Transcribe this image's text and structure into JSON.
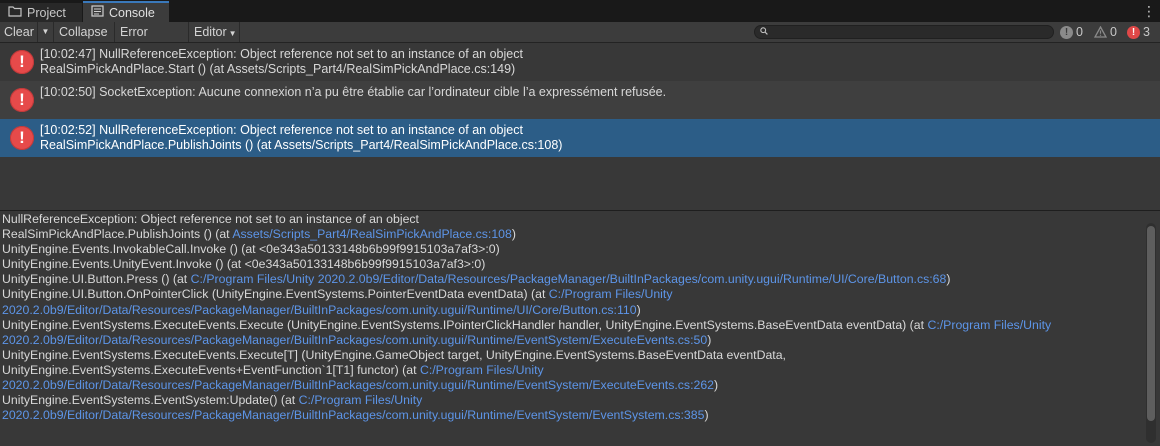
{
  "tabs": [
    {
      "label": "Project",
      "icon": "folder-icon"
    },
    {
      "label": "Console",
      "icon": "console-icon"
    }
  ],
  "toolbar": {
    "clear": "Clear",
    "collapse": "Collapse",
    "error_pause": "Error Pause",
    "editor": "Editor",
    "search_placeholder": "",
    "counts": {
      "log": "0",
      "warning": "0",
      "error": "3"
    }
  },
  "logs": [
    {
      "line1": "[10:02:47] NullReferenceException: Object reference not set to an instance of an object",
      "line2": "RealSimPickAndPlace.Start () (at Assets/Scripts_Part4/RealSimPickAndPlace.cs:149)"
    },
    {
      "line1": "[10:02:50] SocketException: Aucune connexion n’a pu être établie car l’ordinateur cible l’a expressément refusée.",
      "line2": ""
    },
    {
      "line1": "[10:02:52] NullReferenceException: Object reference not set to an instance of an object",
      "line2": "RealSimPickAndPlace.PublishJoints () (at Assets/Scripts_Part4/RealSimPickAndPlace.cs:108)",
      "selected": true
    }
  ],
  "detail": {
    "l01": "NullReferenceException: Object reference not set to an instance of an object",
    "l02a": "RealSimPickAndPlace.PublishJoints () (at ",
    "l02b": "Assets/Scripts_Part4/RealSimPickAndPlace.cs:108",
    "l02c": ")",
    "l03": "UnityEngine.Events.InvokableCall.Invoke () (at <0e343a50133148b6b99f9915103a7af3>:0)",
    "l04": "UnityEngine.Events.UnityEvent.Invoke () (at <0e343a50133148b6b99f9915103a7af3>:0)",
    "l05a": "UnityEngine.UI.Button.Press () (at ",
    "l05b": "C:/Program Files/Unity 2020.2.0b9/Editor/Data/Resources/PackageManager/BuiltInPackages/com.unity.ugui/Runtime/UI/Core/Button.cs:68",
    "l05c": ")",
    "l06a": "UnityEngine.UI.Button.OnPointerClick (UnityEngine.EventSystems.PointerEventData eventData) (at ",
    "l06b": "C:/Program Files/Unity",
    "l07a": "2020.2.0b9/Editor/Data/Resources/PackageManager/BuiltInPackages/com.unity.ugui/Runtime/UI/Core/Button.cs:110",
    "l07b": ")",
    "l08a": "UnityEngine.EventSystems.ExecuteEvents.Execute (UnityEngine.EventSystems.IPointerClickHandler handler, UnityEngine.EventSystems.BaseEventData eventData) (at ",
    "l08b": "C:/Program Files/Unity",
    "l09a": "2020.2.0b9/Editor/Data/Resources/PackageManager/BuiltInPackages/com.unity.ugui/Runtime/EventSystem/ExecuteEvents.cs:50",
    "l09b": ")",
    "l10": "UnityEngine.EventSystems.ExecuteEvents.Execute[T] (UnityEngine.GameObject target, UnityEngine.EventSystems.BaseEventData eventData,",
    "l11a": "UnityEngine.EventSystems.ExecuteEvents+EventFunction`1[T1] functor) (at ",
    "l11b": "C:/Program Files/Unity",
    "l12a": "2020.2.0b9/Editor/Data/Resources/PackageManager/BuiltInPackages/com.unity.ugui/Runtime/EventSystem/ExecuteEvents.cs:262",
    "l12b": ")",
    "l13a": "UnityEngine.EventSystems.EventSystem:Update() (at ",
    "l13b": "C:/Program Files/Unity",
    "l14a": "2020.2.0b9/Editor/Data/Resources/PackageManager/BuiltInPackages/com.unity.ugui/Runtime/EventSystem/EventSystem.cs:385",
    "l14b": ")"
  },
  "colors": {
    "selected_row": "#2c5d87",
    "link": "#5d95e8",
    "error": "#e64a4a",
    "tab_accent": "#3a79bb"
  }
}
